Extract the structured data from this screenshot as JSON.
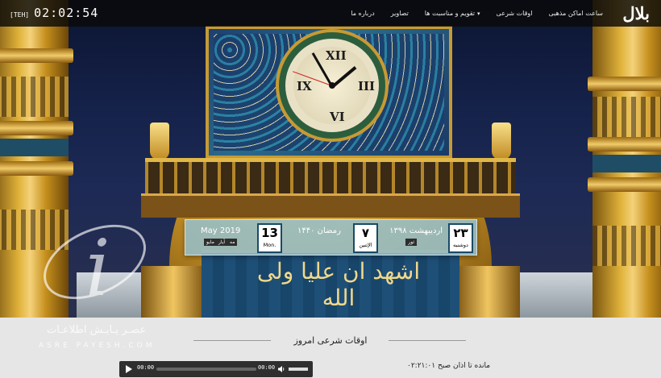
{
  "navbar": {
    "brand": "بلال",
    "items": [
      {
        "label": "ساعت اماکن مذهبی"
      },
      {
        "label": "اوقات شرعی"
      },
      {
        "label": "تقویم و مناسبت ها",
        "has_dropdown": true
      },
      {
        "label": "تصاویر"
      },
      {
        "label": "درباره ما"
      }
    ],
    "clock": {
      "tz": "[TEH]",
      "time": "02:02:54"
    }
  },
  "date_strip": {
    "persian": {
      "day": "۲۳",
      "weekday": "دوشنبه",
      "month_year": "اردیبهشت ۱۳۹۸",
      "tag": "ثور"
    },
    "hijri": {
      "day": "۷",
      "weekday": "الإثنين",
      "month_year": "رمضان ۱۴۴۰"
    },
    "gregorian": {
      "day": "13",
      "weekday": "Mon.",
      "month_year": "May 2019",
      "tags": [
        "مه",
        "آیار",
        "مایو"
      ]
    }
  },
  "hero": {
    "calligraphy": "اشهد ان علیا ولی الله"
  },
  "watermark": {
    "fa": "عصـر پـایـش اطلاعـات",
    "en": "ASRE PAYESH.COM"
  },
  "section": {
    "title": "اوقات شرعی امروز"
  },
  "player": {
    "current": "00:00",
    "duration": "00:00"
  },
  "countdown": "۰۲:۲۱:۰۱ مانده تا اذان صبح"
}
